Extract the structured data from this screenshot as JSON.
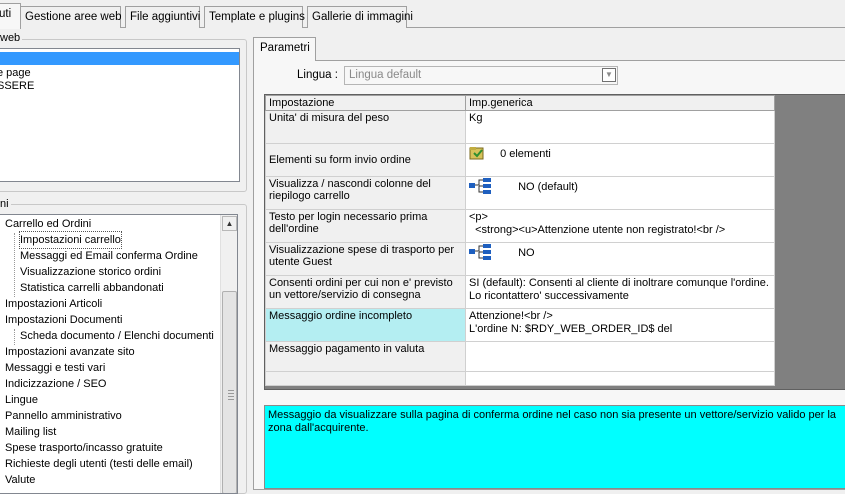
{
  "tabs": [
    {
      "label": "uti"
    },
    {
      "label": "Gestione aree web"
    },
    {
      "label": "File aggiuntivi"
    },
    {
      "label": "Template e plugins"
    },
    {
      "label": "Gallerie di immagini"
    }
  ],
  "left": {
    "group1_title": "web",
    "list_items": [
      "",
      "e page",
      "SSERE"
    ],
    "group2_title": "ni",
    "tree_items": [
      "Carrello ed Ordini",
      "Impostazioni carrello",
      "Messaggi ed Email conferma Ordine",
      "Visualizzazione storico ordini",
      "Statistica carrelli abbandonati",
      "Impostazioni Articoli",
      "Impostazioni Documenti",
      "Scheda documento / Elenchi documenti",
      "Impostazioni avanzate sito",
      "Messaggi e testi vari",
      "Indicizzazione / SEO",
      "Lingue",
      "Pannello amministrativo",
      "Mailing list",
      "Spese trasporto/incasso gratuite",
      "Richieste degli utenti (testi delle email)",
      "Valute"
    ]
  },
  "right": {
    "tab_label": "Parametri",
    "lingua_label": "Lingua :",
    "lingua_value": "Lingua default",
    "grid_headers": [
      "Impostazione",
      "Imp.generica"
    ],
    "rows": [
      {
        "label": "Unita' di misura del peso",
        "value": "Kg",
        "icon": ""
      },
      {
        "label": "Elementi su form invio ordine",
        "value": "0 elementi",
        "icon": "folder-icon"
      },
      {
        "label": "Visualizza / nascondi colonne del riepilogo carrello",
        "value": "NO (default)",
        "icon": "tree-icon"
      },
      {
        "label": "Testo per login necessario prima dell'ordine",
        "value": "<p>\n  <strong><u>Attenzione utente non registrato!<br />",
        "icon": ""
      },
      {
        "label": "Visualizzazione spese di trasporto per utente Guest",
        "value": "NO",
        "icon": "tree-icon"
      },
      {
        "label": "Consenti ordini per cui non e' previsto un vettore/servizio di consegna",
        "value": "SI (default): Consenti al cliente di inoltrare comunque l'ordine. Lo ricontattero' successivamente",
        "icon": ""
      },
      {
        "label": "Messaggio ordine incompleto",
        "value": "Attenzione!<br />\nL'ordine N: $RDY_WEB_ORDER_ID$ del",
        "icon": ""
      },
      {
        "label": "Messaggio pagamento in valuta",
        "value": "",
        "icon": ""
      }
    ],
    "description": "Messaggio da visualizzare sulla pagina di conferma ordine nel caso non sia presente un vettore/servizio valido per la zona dall'acquirente."
  }
}
